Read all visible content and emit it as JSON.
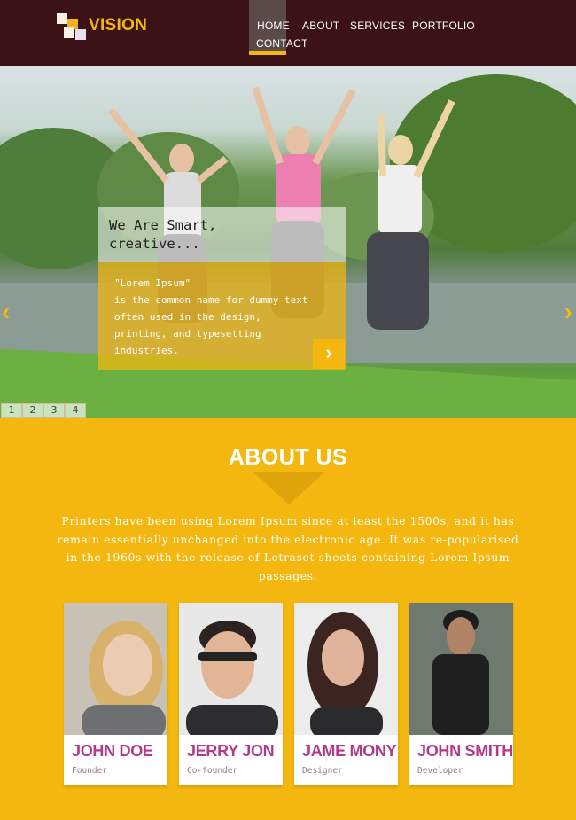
{
  "brand": {
    "name": "VISION"
  },
  "nav": {
    "home_line1": "HOME",
    "home_line2": "CONTACT",
    "about": "ABOUT",
    "services": "SERVICES",
    "portfolio": "PORTFOLIO"
  },
  "hero": {
    "heading": "We Are Smart, creative...",
    "body": "\"Lorem Ipsum\"\nis the common name for dummy text often used in the design, printing, and typesetting industries.",
    "button_icon": "chevron-right-icon",
    "prev_icon": "chevron-left-icon",
    "next_icon": "chevron-right-icon",
    "pages": [
      "1",
      "2",
      "3",
      "4"
    ]
  },
  "about": {
    "title": "ABOUT US",
    "text": "Printers have been using Lorem Ipsum since at least the 1500s, and it has remain essentially unchanged into the electronic age. It was re-popularised in the 1960s with the release of Letraset sheets containing Lorem Ipsum passages."
  },
  "team": [
    {
      "name": "JOHN DOE",
      "role": "Founder"
    },
    {
      "name": "JERRY JON",
      "role": "Co-founder"
    },
    {
      "name": "JAME MONY",
      "role": "Designer"
    },
    {
      "name": "JOHN SMITH",
      "role": "Developer"
    }
  ],
  "colors": {
    "header_bg": "#3b1317",
    "accent": "#f3b70f",
    "name_color": "#b4378a"
  }
}
